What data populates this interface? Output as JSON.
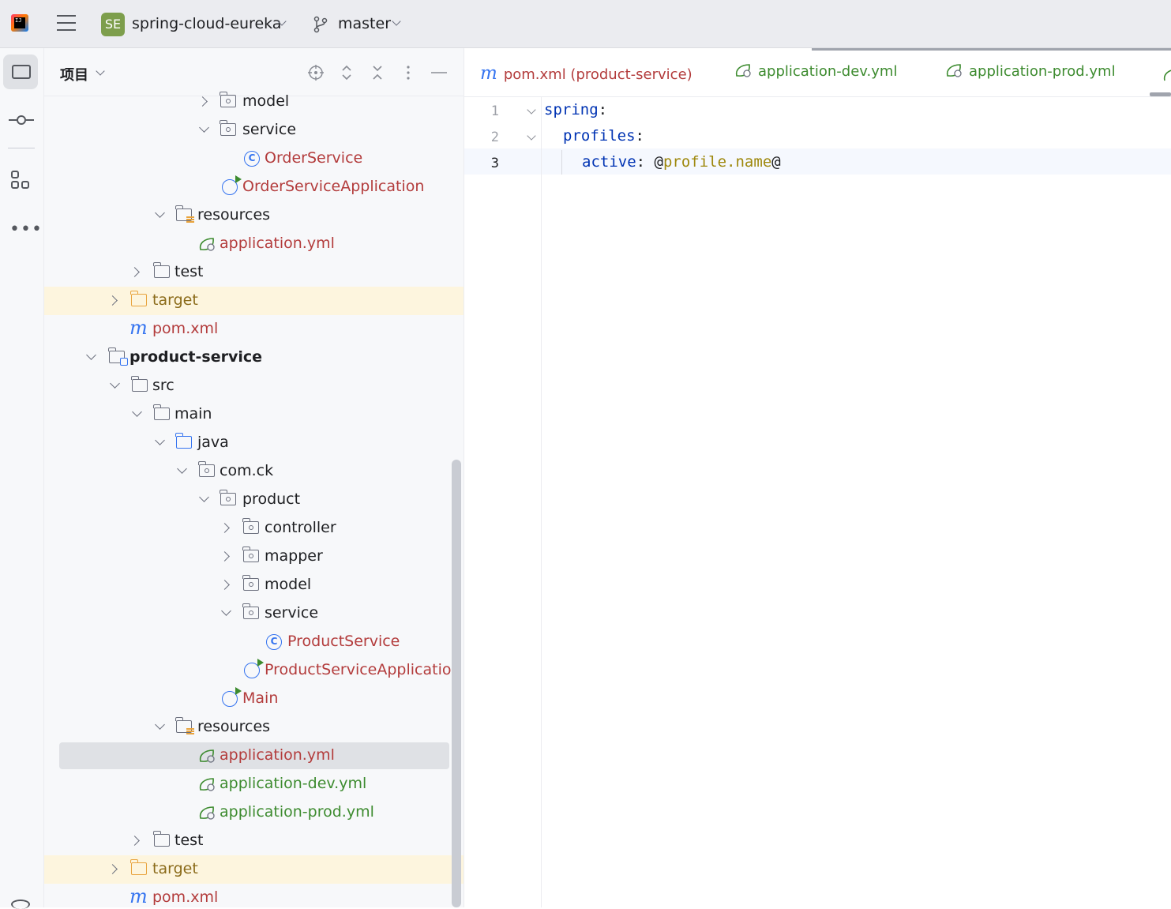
{
  "titlebar": {
    "project_badge": "SE",
    "project_name": "spring-cloud-eureka",
    "branch": "master"
  },
  "toolstrip": {
    "more": "•••"
  },
  "project_panel": {
    "title": "项目",
    "tree": [
      {
        "label": "model",
        "type": "package",
        "state": "collapsed"
      },
      {
        "label": "service",
        "type": "package",
        "state": "expanded"
      },
      {
        "label": "OrderService",
        "type": "class"
      },
      {
        "label": "OrderServiceApplication",
        "type": "app-class"
      },
      {
        "label": "resources",
        "type": "resources",
        "state": "expanded"
      },
      {
        "label": "application.yml",
        "type": "spring-yml"
      },
      {
        "label": "test",
        "type": "folder",
        "state": "collapsed"
      },
      {
        "label": "target",
        "type": "excluded-folder",
        "state": "collapsed"
      },
      {
        "label": "pom.xml",
        "type": "maven"
      },
      {
        "label": "product-service",
        "type": "module",
        "state": "expanded"
      },
      {
        "label": "src",
        "type": "folder",
        "state": "expanded"
      },
      {
        "label": "main",
        "type": "folder",
        "state": "expanded"
      },
      {
        "label": "java",
        "type": "source-folder",
        "state": "expanded"
      },
      {
        "label": "com.ck",
        "type": "package",
        "state": "expanded"
      },
      {
        "label": "product",
        "type": "package",
        "state": "expanded"
      },
      {
        "label": "controller",
        "type": "package",
        "state": "collapsed"
      },
      {
        "label": "mapper",
        "type": "package",
        "state": "collapsed"
      },
      {
        "label": "model",
        "type": "package",
        "state": "collapsed"
      },
      {
        "label": "service",
        "type": "package",
        "state": "expanded"
      },
      {
        "label": "ProductService",
        "type": "class"
      },
      {
        "label": "ProductServiceApplication",
        "type": "app-class"
      },
      {
        "label": "Main",
        "type": "app-class"
      },
      {
        "label": "resources",
        "type": "resources",
        "state": "expanded"
      },
      {
        "label": "application.yml",
        "type": "spring-yml",
        "selected": true
      },
      {
        "label": "application-dev.yml",
        "type": "spring-yml"
      },
      {
        "label": "application-prod.yml",
        "type": "spring-yml"
      },
      {
        "label": "test",
        "type": "folder",
        "state": "collapsed"
      },
      {
        "label": "target",
        "type": "excluded-folder",
        "state": "collapsed"
      },
      {
        "label": "pom.xml",
        "type": "maven"
      }
    ]
  },
  "editor": {
    "tabs": [
      {
        "icon": "m",
        "label": "pom.xml (product-service)"
      },
      {
        "label": "application-dev.yml"
      },
      {
        "label": "application-prod.yml"
      }
    ],
    "line_numbers": [
      "1",
      "2",
      "3"
    ],
    "code": {
      "line1_key": "spring",
      "line1_colon": ":",
      "line2_key": "profiles",
      "line2_colon": ":",
      "line3_key": "active",
      "line3_colon": ": ",
      "line3_at1": "@",
      "line3_placeholder": "profile.name",
      "line3_at2": "@"
    }
  },
  "colors": {
    "titlebar_bg": "#ebecf0",
    "panel_bg": "#f7f8fa",
    "target_highlight": "#fdf5de",
    "selection": "#dfe1e5",
    "yaml_key": "#0033b3",
    "template_text": "#9e880d",
    "modified_red": "#b33c3c",
    "new_green": "#3d8b2f",
    "accent_blue": "#3574f0"
  }
}
